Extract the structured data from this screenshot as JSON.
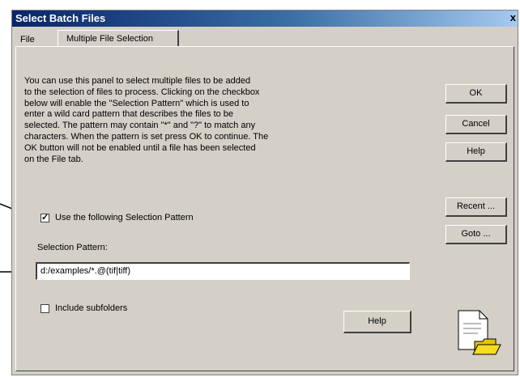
{
  "window": {
    "title": "Select Batch Files",
    "close_glyph": "x"
  },
  "tabs": [
    {
      "label": "File"
    },
    {
      "label": "Multiple File Selection",
      "active": true
    }
  ],
  "panel": {
    "description": "You can use this panel to select multiple files to be added\nto the selection of files to process. Clicking on the checkbox\nbelow will enable the \"Selection Pattern\" which is used to\nenter a wild card pattern that describes the files to be\nselected. The pattern may contain \"*\" and \"?\" to match any\ncharacters. When the pattern is set press OK to continue. The\nOK button will not be enabled until a file has been selected\non the File tab.",
    "use_pattern": {
      "label": "Use the following Selection Pattern",
      "checked": true
    },
    "pattern": {
      "label": "Selection Pattern:",
      "value": "d:/examples/*.@(tif|tiff)"
    },
    "subfolders": {
      "label": "Include subfolders",
      "checked": false
    },
    "help_label": "Help"
  },
  "buttons": {
    "ok": "OK",
    "cancel": "Cancel",
    "help": "Help",
    "recent": "Recent ...",
    "goto": "Goto ..."
  },
  "icons": {
    "folder_doc": "document-folder-icon"
  }
}
